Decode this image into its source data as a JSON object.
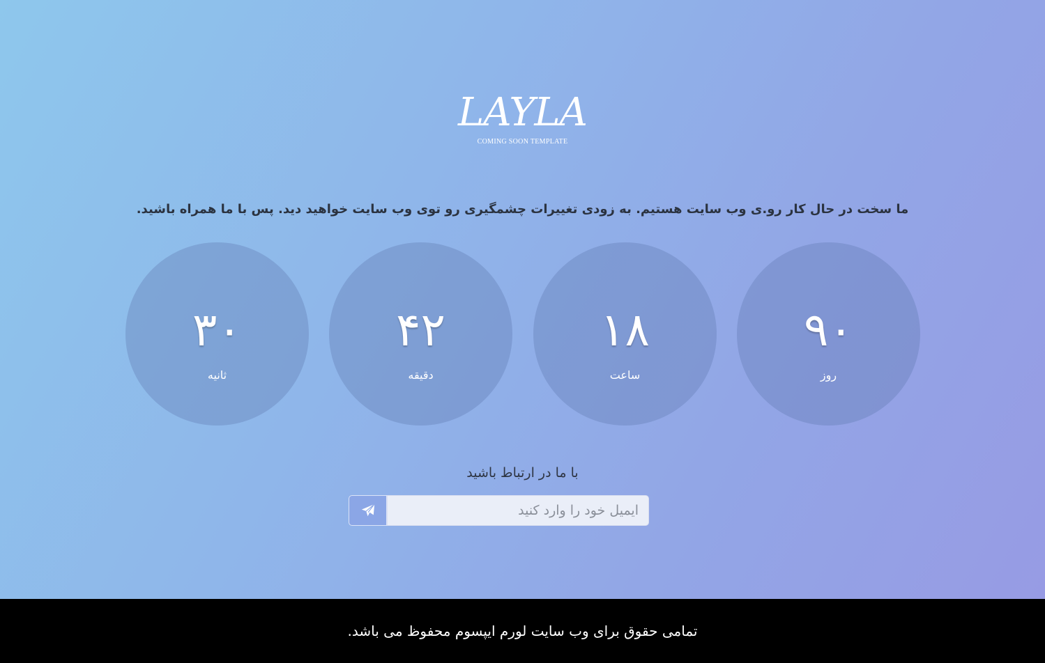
{
  "brand": {
    "logo_text": "LAYLA",
    "logo_subtitle": "COMING SOON TEMPLATE"
  },
  "tagline": "ما سخت در حال کار رو.ی وب سایت هستیم. به زودی تغییرات چشمگیری رو توی وب سایت خواهید دید. پس با ما همراه باشید.",
  "countdown": {
    "days": {
      "value": "۹۰",
      "label": "روز"
    },
    "hours": {
      "value": "۱۸",
      "label": "ساعت"
    },
    "minutes": {
      "value": "۴۲",
      "label": "دقیقه"
    },
    "seconds": {
      "value": "۳۰",
      "label": "ثانیه"
    }
  },
  "contact": {
    "title": "با ما در ارتباط باشید",
    "email_placeholder": "ایمیل خود را وارد کنید",
    "email_value": "",
    "send_icon": "paper-plane-icon"
  },
  "footer": {
    "copyright": "تمامی حقوق برای وب سایت لورم ایپسوم محفوظ می باشد."
  },
  "colors": {
    "gradient_start": "#8ec7ec",
    "gradient_end": "#979be4",
    "footer_bg": "#000000",
    "circle_fill": "rgba(95,120,175,0.35)"
  }
}
